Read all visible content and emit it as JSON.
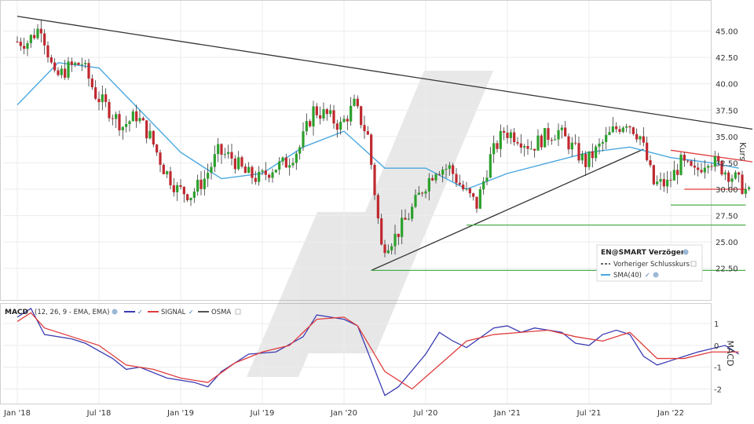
{
  "chart_data": [
    {
      "type": "candlestick",
      "title": "",
      "ylabel": "Kurs",
      "xlabel": "",
      "ylim": [
        19.5,
        47.5
      ],
      "yticks": [
        "45.00",
        "42.50",
        "40.00",
        "37.50",
        "35.00",
        "32.50",
        "30.00",
        "27.50",
        "25.00",
        "22.50"
      ],
      "xticks": [
        "Jan '18",
        "Jul '18",
        "Jan '19",
        "Jul '19",
        "Jan '20",
        "Jul '20",
        "Jan '21",
        "Jul '21",
        "Jan '22"
      ],
      "grid": true,
      "legend_position": "bottom-right",
      "legend": {
        "title": "EN@SMART Verzögert",
        "items": [
          "Vorheriger Schlusskurs",
          "SMA(40)"
        ]
      },
      "series": [
        {
          "name": "Kurs",
          "style": "candlestick",
          "x": [
            "2018-01",
            "2018-02",
            "2018-03",
            "2018-04",
            "2018-05",
            "2018-06",
            "2018-07",
            "2018-08",
            "2018-09",
            "2018-10",
            "2018-11",
            "2018-12",
            "2019-01",
            "2019-02",
            "2019-03",
            "2019-04",
            "2019-05",
            "2019-06",
            "2019-07",
            "2019-08",
            "2019-09",
            "2019-10",
            "2019-11",
            "2019-12",
            "2020-01",
            "2020-02",
            "2020-03",
            "2020-04",
            "2020-05",
            "2020-06",
            "2020-07",
            "2020-08",
            "2020-09",
            "2020-10",
            "2020-11",
            "2020-12",
            "2021-01",
            "2021-02",
            "2021-03",
            "2021-04",
            "2021-05",
            "2021-06",
            "2021-07",
            "2021-08",
            "2021-09",
            "2021-10",
            "2021-11",
            "2021-12",
            "2022-01",
            "2022-02",
            "2022-03",
            "2022-04",
            "2022-05",
            "2022-06"
          ],
          "close": [
            44.0,
            45.5,
            40.5,
            41.5,
            42.0,
            39.0,
            37.5,
            36.0,
            37.0,
            35.0,
            32.0,
            30.0,
            29.5,
            31.0,
            33.5,
            33.0,
            31.5,
            31.0,
            32.0,
            32.5,
            34.0,
            37.5,
            37.0,
            36.0,
            38.0,
            35.0,
            24.5,
            25.5,
            27.5,
            30.0,
            32.0,
            32.0,
            30.0,
            28.5,
            33.0,
            35.5,
            35.0,
            34.0,
            35.0,
            35.5,
            34.0,
            32.5,
            34.0,
            35.5,
            36.5,
            35.0,
            30.5,
            30.5,
            32.5,
            31.5,
            33.0,
            32.0,
            31.0,
            29.5
          ]
        },
        {
          "name": "SMA(40)",
          "style": "line",
          "color": "#4aa8e0",
          "x": [
            "2018-01",
            "2018-04",
            "2018-07",
            "2018-10",
            "2019-01",
            "2019-04",
            "2019-07",
            "2019-10",
            "2020-01",
            "2020-04",
            "2020-07",
            "2020-10",
            "2021-01",
            "2021-04",
            "2021-07",
            "2021-10",
            "2022-01",
            "2022-04",
            "2022-06"
          ],
          "values": [
            38.0,
            42.0,
            41.5,
            37.5,
            33.5,
            31.0,
            31.5,
            34.0,
            35.5,
            32.0,
            32.0,
            30.0,
            31.5,
            32.5,
            33.5,
            34.0,
            33.0,
            32.5,
            32.0
          ]
        }
      ],
      "annotations": [
        {
          "type": "trendline",
          "color": "#333333",
          "from": [
            "2018-01",
            46.4
          ],
          "to": [
            "2022-06",
            35.7
          ]
        },
        {
          "type": "trendline",
          "color": "#333333",
          "from": [
            "2020-03",
            22.3
          ],
          "to": [
            "2021-10",
            33.8
          ]
        },
        {
          "type": "trendline",
          "color": "#e03c3c",
          "from": [
            "2022-01",
            33.7
          ],
          "to": [
            "2022-06",
            32.6
          ]
        },
        {
          "type": "hline",
          "color": "#4caf50",
          "value": 22.3,
          "from": "2020-03",
          "to": "2022-06"
        },
        {
          "type": "hline",
          "color": "#4caf50",
          "value": 26.6,
          "from": "2020-10",
          "to": "2022-06"
        },
        {
          "type": "hline",
          "color": "#4caf50",
          "value": 28.5,
          "from": "2022-01",
          "to": "2022-06"
        },
        {
          "type": "hline",
          "color": "#e03c3c",
          "value": 30.0,
          "from": "2022-02",
          "to": "2022-06"
        }
      ]
    },
    {
      "type": "line",
      "title": "MACD",
      "params": "(12, 26, 9 - EMA, EMA)",
      "ylabel": "MACD",
      "ylim": [
        -2.6,
        1.8
      ],
      "yticks": [
        "1",
        "0",
        "-1",
        "-2"
      ],
      "grid": true,
      "legend_position": "top-left",
      "series": [
        {
          "name": "MACD",
          "color": "#3b3bb3",
          "x": [
            "2018-01",
            "2018-02",
            "2018-03",
            "2018-05",
            "2018-06",
            "2018-08",
            "2018-09",
            "2018-10",
            "2018-12",
            "2019-02",
            "2019-03",
            "2019-04",
            "2019-06",
            "2019-08",
            "2019-10",
            "2019-11",
            "2020-01",
            "2020-02",
            "2020-04",
            "2020-05",
            "2020-07",
            "2020-08",
            "2020-09",
            "2020-10",
            "2020-12",
            "2021-01",
            "2021-02",
            "2021-03",
            "2021-05",
            "2021-06",
            "2021-07",
            "2021-08",
            "2021-09",
            "2021-10",
            "2021-11",
            "2021-12",
            "2022-01",
            "2022-02",
            "2022-03",
            "2022-05",
            "2022-06"
          ],
          "values": [
            1.3,
            1.7,
            0.5,
            0.3,
            0.1,
            -0.6,
            -1.1,
            -1.0,
            -1.5,
            -1.7,
            -1.9,
            -1.2,
            -0.4,
            -0.3,
            0.4,
            1.4,
            1.2,
            0.9,
            -2.3,
            -1.9,
            -0.4,
            0.6,
            0.2,
            -0.1,
            0.8,
            0.9,
            0.6,
            0.8,
            0.6,
            0.1,
            0.0,
            0.5,
            0.7,
            0.5,
            -0.5,
            -0.9,
            -0.7,
            -0.5,
            -0.3,
            0.0,
            -0.4
          ]
        },
        {
          "name": "SIGNAL",
          "color": "#e03c3c",
          "x": [
            "2018-01",
            "2018-02",
            "2018-03",
            "2018-05",
            "2018-07",
            "2018-09",
            "2018-11",
            "2019-01",
            "2019-03",
            "2019-05",
            "2019-07",
            "2019-09",
            "2019-11",
            "2020-01",
            "2020-02",
            "2020-04",
            "2020-06",
            "2020-08",
            "2020-10",
            "2020-12",
            "2021-02",
            "2021-04",
            "2021-06",
            "2021-08",
            "2021-10",
            "2021-12",
            "2022-02",
            "2022-04",
            "2022-06"
          ],
          "values": [
            1.1,
            1.5,
            0.8,
            0.4,
            0.0,
            -0.9,
            -1.1,
            -1.5,
            -1.7,
            -0.8,
            -0.3,
            0.0,
            1.2,
            1.3,
            0.9,
            -1.2,
            -2.0,
            -0.9,
            0.2,
            0.5,
            0.6,
            0.7,
            0.4,
            0.2,
            0.6,
            -0.6,
            -0.6,
            -0.3,
            -0.3
          ]
        },
        {
          "name": "OSMA",
          "color": "#555555",
          "x": [],
          "values": []
        }
      ]
    }
  ]
}
